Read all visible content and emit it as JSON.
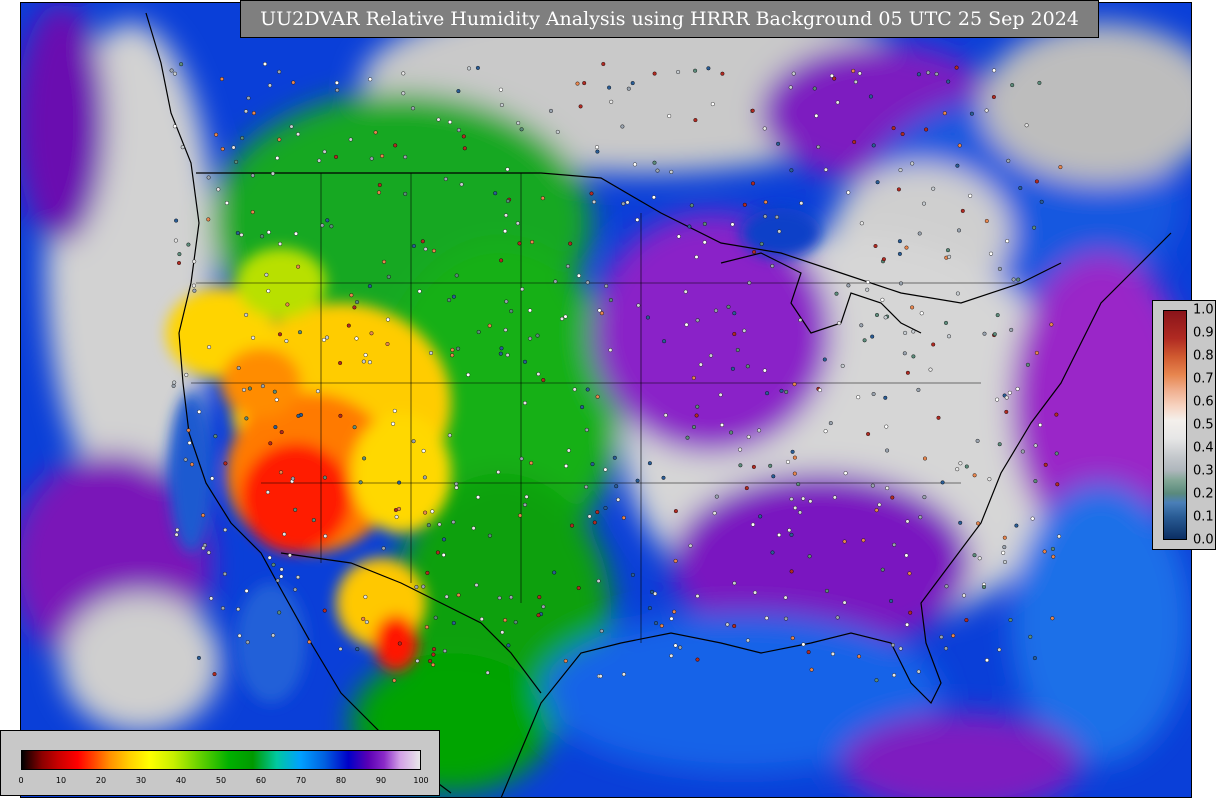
{
  "title": "UU2DVAR Relative Humidity Analysis using HRRR Background 05 UTC 25 Sep 2024",
  "colorbar_rh": {
    "ticks": [
      "0",
      "10",
      "20",
      "30",
      "40",
      "50",
      "60",
      "70",
      "80",
      "90",
      "100"
    ]
  },
  "colorbar_station": {
    "ticks": [
      "1.0",
      "0.9",
      "0.8",
      "0.7",
      "0.6",
      "0.5",
      "0.4",
      "0.3",
      "0.2",
      "0.1",
      "0.0"
    ]
  },
  "colors": {
    "ocean_dry_background": "#cccccc",
    "very_dry": "#ff0000",
    "dry": "#ffd000",
    "moderate": "#00b000",
    "moist": "#0050e0",
    "very_moist": "#7000b0",
    "saturated": "#d8d8d8"
  }
}
